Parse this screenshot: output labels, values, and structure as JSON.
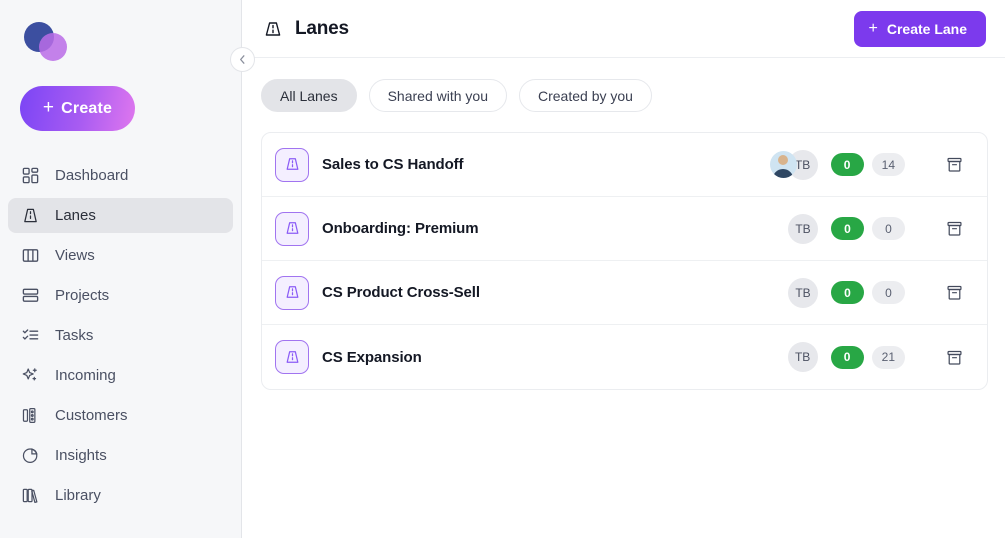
{
  "sidebar": {
    "logo_name": "app-logo",
    "create_button": {
      "label": "Create",
      "plus": "+"
    },
    "items": [
      {
        "label": "Dashboard",
        "icon": "dashboard-icon",
        "active": false
      },
      {
        "label": "Lanes",
        "icon": "lanes-icon",
        "active": true
      },
      {
        "label": "Views",
        "icon": "views-icon",
        "active": false
      },
      {
        "label": "Projects",
        "icon": "projects-icon",
        "active": false
      },
      {
        "label": "Tasks",
        "icon": "tasks-icon",
        "active": false
      },
      {
        "label": "Incoming",
        "icon": "sparkle-icon",
        "active": false
      },
      {
        "label": "Customers",
        "icon": "customers-icon",
        "active": false
      },
      {
        "label": "Insights",
        "icon": "pie-chart-icon",
        "active": false
      },
      {
        "label": "Library",
        "icon": "library-icon",
        "active": false
      }
    ],
    "collapse_label": "‹"
  },
  "header": {
    "title": "Lanes",
    "icon": "lanes-icon",
    "create_lane": {
      "label": "Create Lane",
      "plus": "+"
    }
  },
  "filters": [
    {
      "label": "All Lanes",
      "active": true
    },
    {
      "label": "Shared with you",
      "active": false
    },
    {
      "label": "Created by you",
      "active": false
    }
  ],
  "lanes": [
    {
      "name": "Sales to CS Handoff",
      "has_photo_avatar": true,
      "initials": "TB",
      "green_badge": "0",
      "gray_badge": "14"
    },
    {
      "name": "Onboarding: Premium",
      "has_photo_avatar": false,
      "initials": "TB",
      "green_badge": "0",
      "gray_badge": "0"
    },
    {
      "name": "CS Product Cross-Sell",
      "has_photo_avatar": false,
      "initials": "TB",
      "green_badge": "0",
      "gray_badge": "0"
    },
    {
      "name": "CS Expansion",
      "has_photo_avatar": false,
      "initials": "TB",
      "green_badge": "0",
      "gray_badge": "21"
    }
  ],
  "colors": {
    "brand_purple": "#7c3aed",
    "green_badge": "#28a745",
    "sidebar_bg": "#f6f7f9",
    "active_item": "#e3e4e8"
  }
}
